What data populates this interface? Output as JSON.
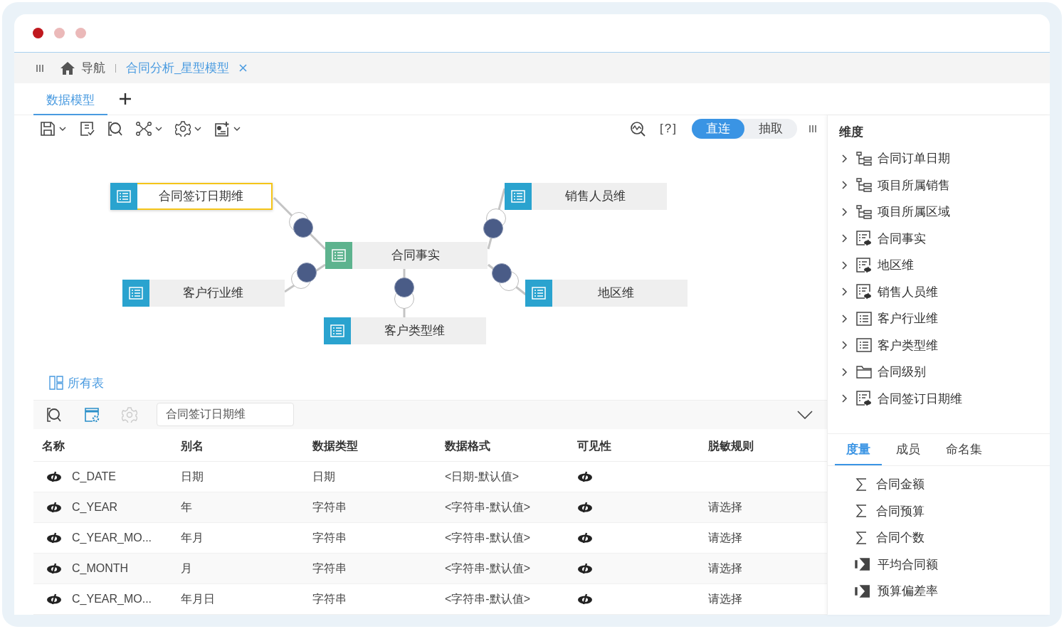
{
  "nav_bar": {
    "home_label": "导航",
    "open_tab": "合同分析_星型模型"
  },
  "tabs": [
    {
      "label": "数据模型",
      "selected": true
    }
  ],
  "toolbar": {
    "help": "[?]",
    "modes": [
      {
        "label": "直连",
        "selected": true
      },
      {
        "label": "抽取",
        "selected": false
      }
    ]
  },
  "diagram": {
    "nodes": [
      {
        "label": "合同签订日期维",
        "kind": "dimension",
        "selected": true
      },
      {
        "label": "销售人员维",
        "kind": "dimension",
        "selected": false
      },
      {
        "label": "合同事实",
        "kind": "fact",
        "selected": false
      },
      {
        "label": "客户行业维",
        "kind": "dimension",
        "selected": false
      },
      {
        "label": "地区维",
        "kind": "dimension",
        "selected": false
      },
      {
        "label": "客户类型维",
        "kind": "dimension",
        "selected": false
      }
    ]
  },
  "all_tables_link": "所有表",
  "detail": {
    "table_field": "合同签订日期维",
    "columns": [
      "名称",
      "别名",
      "数据类型",
      "数据格式",
      "可见性",
      "脱敏规则"
    ],
    "rows": [
      {
        "name": "C_DATE",
        "alias": "日期",
        "type": "日期",
        "format": "<日期-默认值>"
      },
      {
        "name": "C_YEAR",
        "alias": "年",
        "type": "字符串",
        "format": "<字符串-默认值>",
        "masking": "请选择"
      },
      {
        "name": "C_YEAR_MO...",
        "alias": "年月",
        "type": "字符串",
        "format": "<字符串-默认值>",
        "masking": "请选择"
      },
      {
        "name": "C_MONTH",
        "alias": "月",
        "type": "字符串",
        "format": "<字符串-默认值>",
        "masking": "请选择"
      },
      {
        "name": "C_YEAR_MO...",
        "alias": "年月日",
        "type": "字符串",
        "format": "<字符串-默认值>",
        "masking": "请选择"
      }
    ]
  },
  "sidebar": {
    "title": "维度",
    "items": [
      {
        "label": "合同订单日期",
        "kind": "hierarchy",
        "expanded": false
      },
      {
        "label": "项目所属销售",
        "kind": "hierarchy",
        "expanded": false
      },
      {
        "label": "项目所属区域",
        "kind": "hierarchy",
        "expanded": false
      },
      {
        "label": "合同事实",
        "kind": "table-eye",
        "expanded": false
      },
      {
        "label": "地区维",
        "kind": "table-eye",
        "expanded": false
      },
      {
        "label": "销售人员维",
        "kind": "table-eye",
        "expanded": false
      },
      {
        "label": "客户行业维",
        "kind": "table",
        "expanded": false
      },
      {
        "label": "客户类型维",
        "kind": "table",
        "expanded": false
      },
      {
        "label": "合同级别",
        "kind": "folder",
        "expanded": false
      },
      {
        "label": "合同签订日期维",
        "kind": "table-eye",
        "expanded": false
      }
    ],
    "tabs": [
      {
        "label": "度量",
        "selected": true
      },
      {
        "label": "成员",
        "selected": false
      },
      {
        "label": "命名集",
        "selected": false
      }
    ],
    "measures": [
      {
        "label": "合同金额",
        "kind": "sum"
      },
      {
        "label": "合同预算",
        "kind": "sum"
      },
      {
        "label": "合同个数",
        "kind": "sum"
      },
      {
        "label": "平均合同额",
        "kind": "calc"
      },
      {
        "label": "预算偏差率",
        "kind": "calc"
      }
    ]
  }
}
